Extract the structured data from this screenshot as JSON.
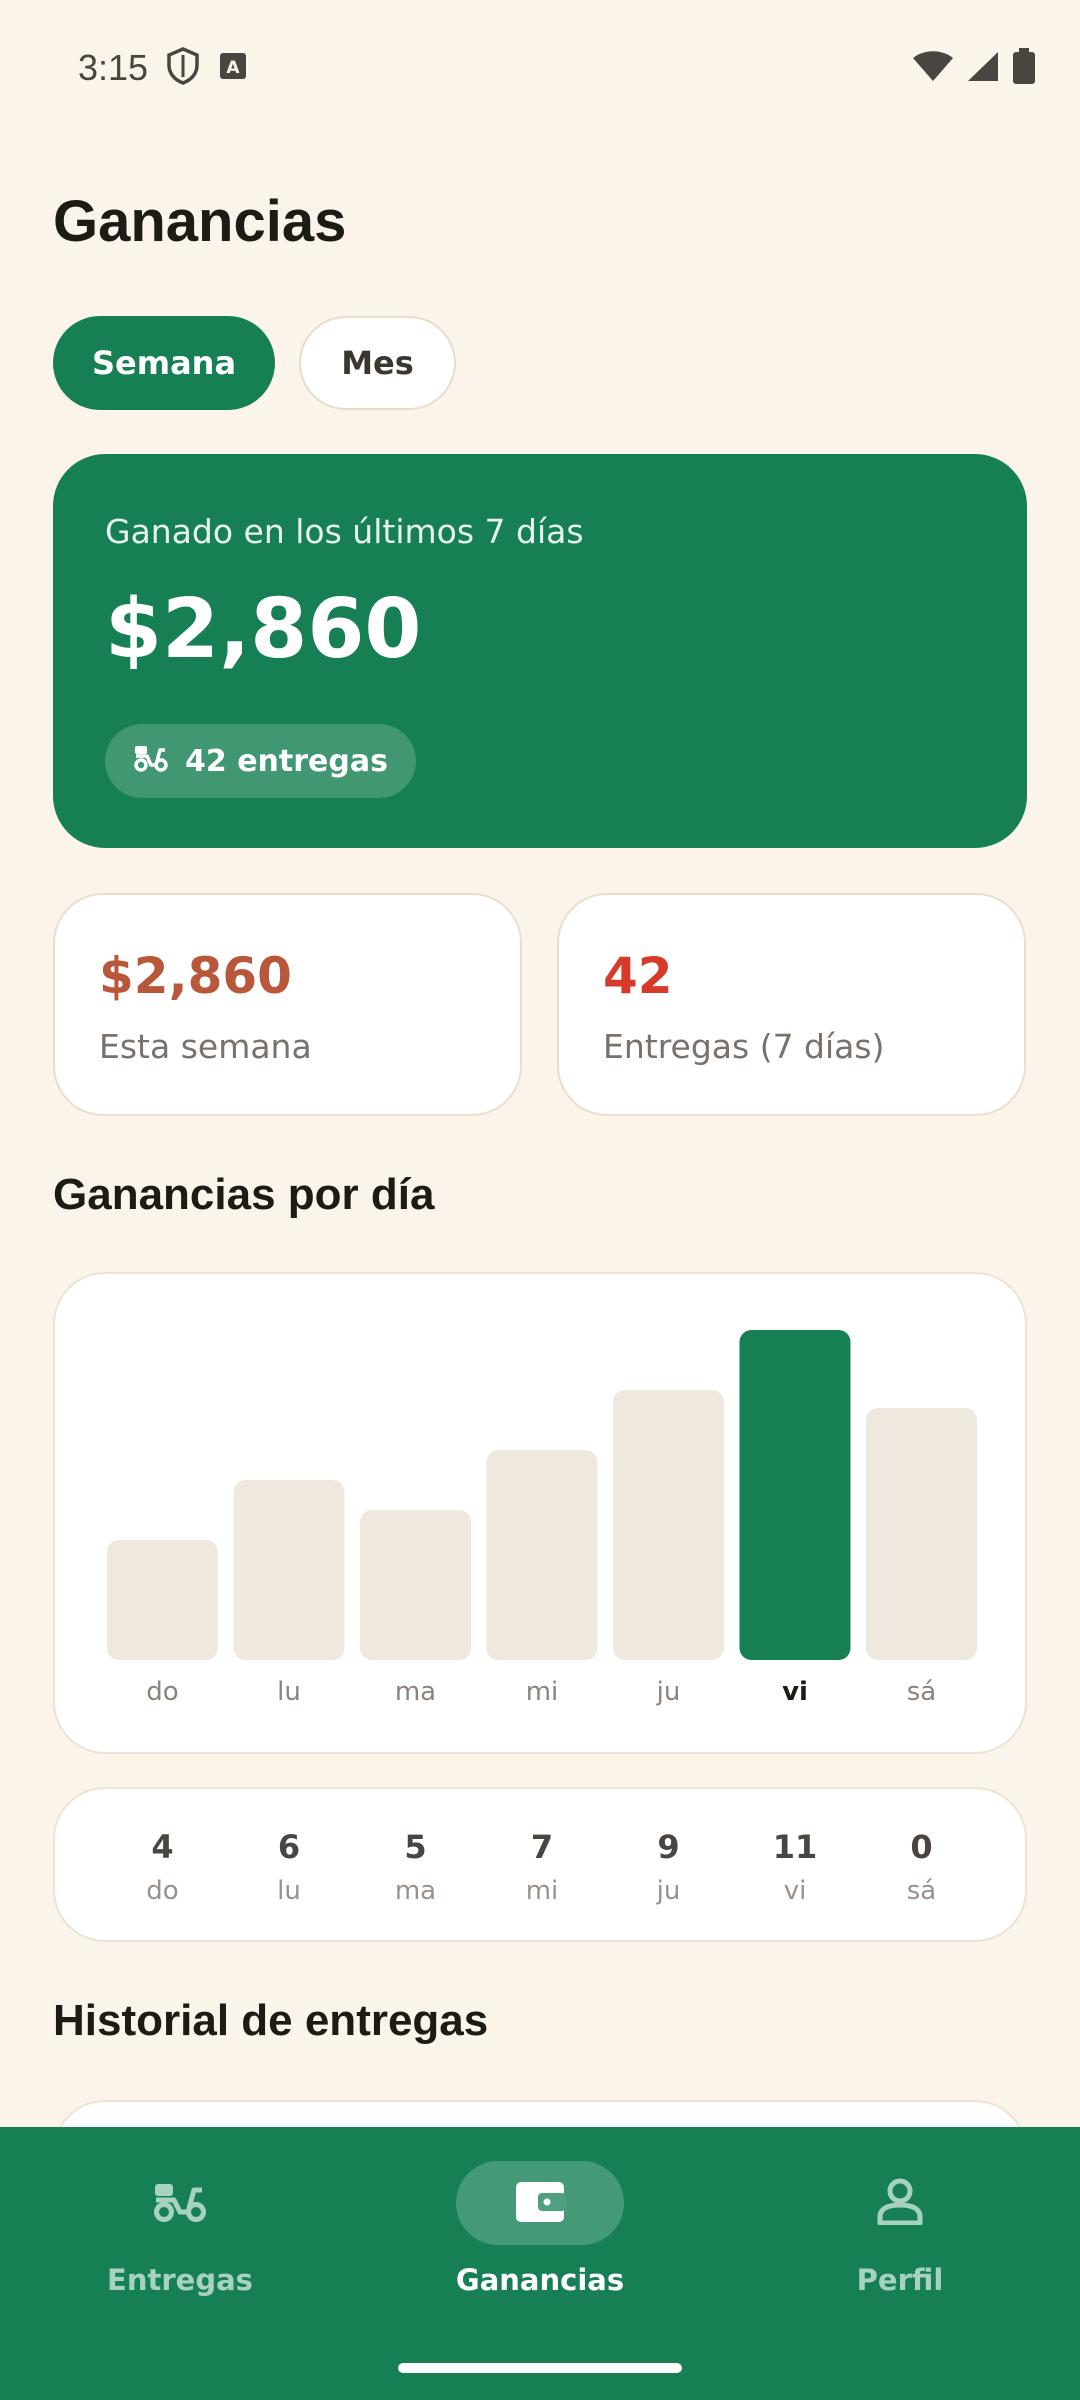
{
  "status_bar": {
    "time": "3:15"
  },
  "page": {
    "title": "Ganancias"
  },
  "tabs": [
    {
      "label": "Semana",
      "active": true
    },
    {
      "label": "Mes",
      "active": false
    }
  ],
  "summary": {
    "caption": "Ganado en los últimos 7 días",
    "amount": "$2,860",
    "deliveries_badge": "42 entregas"
  },
  "stats": [
    {
      "value": "$2,860",
      "label": "Esta semana",
      "color": "#B8573A"
    },
    {
      "value": "42",
      "label": "Entregas (7 días)",
      "color": "#D83A2A"
    }
  ],
  "daily_section": {
    "title": "Ganancias por día"
  },
  "chart_data": {
    "type": "bar",
    "categories": [
      "do",
      "lu",
      "ma",
      "mi",
      "ju",
      "vi",
      "sá"
    ],
    "values": [
      4,
      6,
      5,
      7,
      9,
      11,
      8.4
    ],
    "highlight_index": 5,
    "highlight_color": "#168054",
    "bar_color": "#EFE8DE",
    "grid": false,
    "ylim": [
      0,
      11
    ]
  },
  "daily_counts": [
    {
      "count": "4",
      "day": "do"
    },
    {
      "count": "6",
      "day": "lu"
    },
    {
      "count": "5",
      "day": "ma"
    },
    {
      "count": "7",
      "day": "mi"
    },
    {
      "count": "9",
      "day": "ju"
    },
    {
      "count": "11",
      "day": "vi"
    },
    {
      "count": "0",
      "day": "sá"
    }
  ],
  "history_section": {
    "title": "Historial de entregas"
  },
  "bottom_nav": [
    {
      "label": "Entregas",
      "icon": "scooter-icon",
      "active": false
    },
    {
      "label": "Ganancias",
      "icon": "wallet-icon",
      "active": true
    },
    {
      "label": "Perfil",
      "icon": "person-icon",
      "active": false
    }
  ],
  "colors": {
    "brand": "#168054",
    "background": "#FAF4EB"
  }
}
